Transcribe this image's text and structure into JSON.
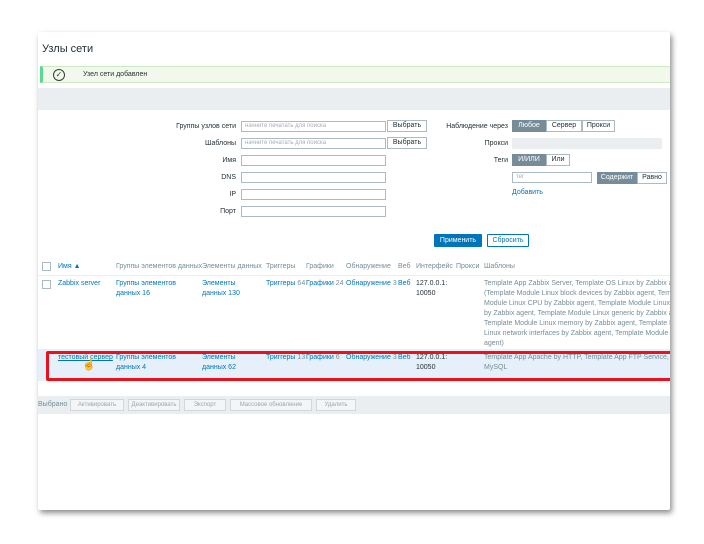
{
  "page": {
    "title": "Узлы сети"
  },
  "message": {
    "text": "Узел сети добавлен"
  },
  "filter": {
    "host_groups_label": "Группы узлов сети",
    "host_groups_placeholder": "начните печатать для поиска",
    "templates_label": "Шаблоны",
    "templates_placeholder": "начните печатать для поиска",
    "select_label": "Выбрать",
    "name_label": "Имя",
    "dns_label": "DNS",
    "ip_label": "IP",
    "port_label": "Порт",
    "monitored_by_label": "Наблюдение через",
    "monitored_by_options": [
      "Любое",
      "Сервер",
      "Прокси"
    ],
    "proxy_label": "Прокси",
    "tags_label": "Теги",
    "tags_options": [
      "И/ИЛИ",
      "Или"
    ],
    "tag_placeholder": "тег",
    "tag_operator_options": [
      "Содержит",
      "Равно"
    ],
    "add_link": "Добавить",
    "apply_label": "Применить",
    "reset_label": "Сбросить"
  },
  "table": {
    "headers": [
      "Имя ▲",
      "Группы элементов данных",
      "Элементы данных",
      "Триггеры",
      "Графики",
      "Обнаружение",
      "Веб",
      "Интерфейс",
      "Прокси",
      "Шаблоны"
    ],
    "rows": [
      {
        "name": "Zabbix server",
        "item_groups": "Группы элементов",
        "item_groups_count": "данных 16",
        "items": "Элементы",
        "items_count": "данных 130",
        "triggers": "Триггеры",
        "triggers_count": "64",
        "graphs": "Графики",
        "graphs_count": "24",
        "discovery": "Обнаружение",
        "discovery_count": "3",
        "web": "Веб",
        "interface1": "127.0.0.1:",
        "interface2": "10050",
        "templates": [
          "Template App Zabbix Server, Template OS Linux by Zabbix agent",
          "(Template Module Linux block devices by Zabbix agent, Template",
          "Module Linux CPU by Zabbix agent, Template Module Linux file",
          "by Zabbix agent, Template Module Linux generic by Zabbix agent,",
          "Template Module Linux memory by Zabbix agent, Template Module",
          "Linux network interfaces by Zabbix agent, Template Module Zabbix",
          "agent)"
        ]
      },
      {
        "name": "тестовый сервер",
        "item_groups": "Группы элементов",
        "item_groups_count": "данных 4",
        "items": "Элементы",
        "items_count": "данных 62",
        "triggers": "Триггеры",
        "triggers_count": "13",
        "graphs": "Графики",
        "graphs_count": "6",
        "discovery": "Обнаружение",
        "discovery_count": "3",
        "web": "Веб",
        "interface1": "127.0.0.1:",
        "interface2": "10050",
        "templates": [
          "Template App Apache by HTTP, Template App FTP Service, Template DB",
          "MySQL"
        ]
      }
    ]
  },
  "bottom": {
    "selected_label": "Выбрано",
    "buttons": [
      "Активировать",
      "Деактивировать",
      "Экспорт",
      "Массовое обновление",
      "Удалить"
    ]
  }
}
